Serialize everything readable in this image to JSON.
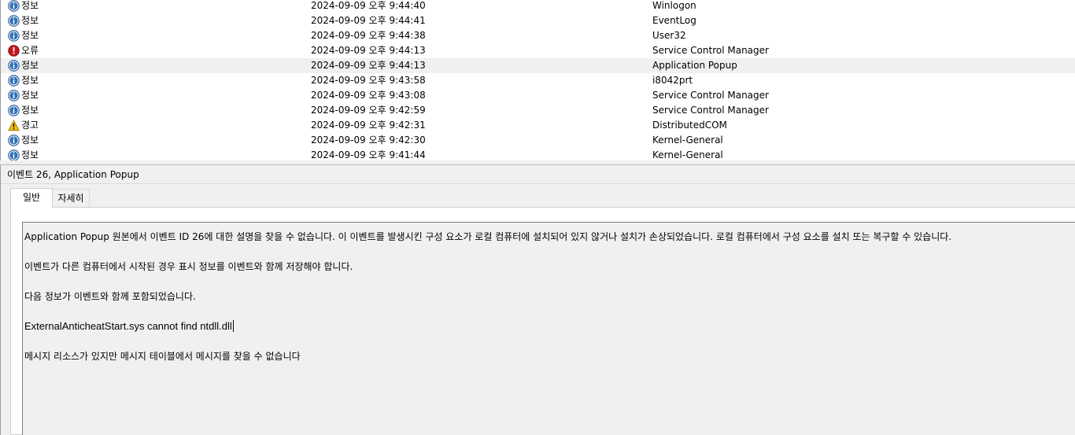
{
  "events": [
    {
      "level": "정보",
      "icon": "info-icon",
      "date": "2024-09-09 오후 9:44:40",
      "source": "Winlogon"
    },
    {
      "level": "정보",
      "icon": "info-icon",
      "date": "2024-09-09 오후 9:44:41",
      "source": "EventLog"
    },
    {
      "level": "정보",
      "icon": "info-icon",
      "date": "2024-09-09 오후 9:44:38",
      "source": "User32"
    },
    {
      "level": "오류",
      "icon": "error-icon",
      "date": "2024-09-09 오후 9:44:13",
      "source": "Service Control Manager"
    },
    {
      "level": "정보",
      "icon": "info-icon",
      "date": "2024-09-09 오후 9:44:13",
      "source": "Application Popup",
      "selected": true
    },
    {
      "level": "정보",
      "icon": "info-icon",
      "date": "2024-09-09 오후 9:43:58",
      "source": "i8042prt"
    },
    {
      "level": "정보",
      "icon": "info-icon",
      "date": "2024-09-09 오후 9:43:08",
      "source": "Service Control Manager"
    },
    {
      "level": "정보",
      "icon": "info-icon",
      "date": "2024-09-09 오후 9:42:59",
      "source": "Service Control Manager"
    },
    {
      "level": "경고",
      "icon": "warning-icon",
      "date": "2024-09-09 오후 9:42:31",
      "source": "DistributedCOM"
    },
    {
      "level": "정보",
      "icon": "info-icon",
      "date": "2024-09-09 오후 9:42:30",
      "source": "Kernel-General"
    },
    {
      "level": "정보",
      "icon": "info-icon",
      "date": "2024-09-09 오후 9:41:44",
      "source": "Kernel-General"
    }
  ],
  "detail": {
    "title": "이벤트 26, Application Popup",
    "tabs": {
      "general": "일반",
      "details": "자세히"
    },
    "message": {
      "line1": "Application Popup 원본에서 이벤트 ID 26에 대한 설명을 찾을 수 없습니다. 이 이벤트를 발생시킨 구성 요소가 로컬 컴퓨터에 설치되어 있지 않거나 설치가 손상되었습니다. 로컬 컴퓨터에서 구성 요소를 설치 또는 복구할 수 있습니다.",
      "line2": "이벤트가 다른 컴퓨터에서 시작된 경우 표시 정보를 이벤트와 함께 저장해야 합니다.",
      "line3": "다음 정보가 이벤트와 함께 포함되었습니다.",
      "line4": "ExternalAnticheatStart.sys cannot find ntdll.dll",
      "line5": "메시지 리소스가 있지만 메시지 테이블에서 메시지를 찾을 수 없습니다"
    }
  },
  "colors": {
    "info": "#2f6fb5",
    "error": "#c4161c",
    "warning": "#f2c200",
    "selected_row": "#f0f0f0"
  }
}
